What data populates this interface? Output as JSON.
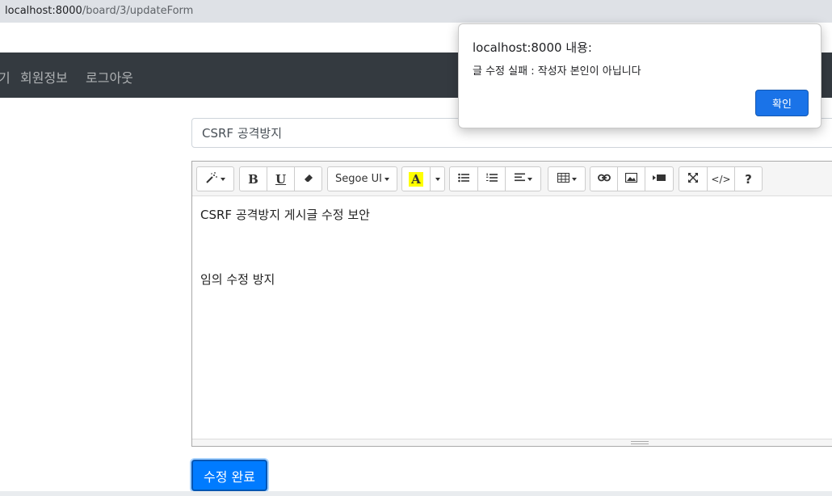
{
  "browser": {
    "url_host": "localhost:8000",
    "url_path": "/board/3/updateForm"
  },
  "navbar": {
    "items": [
      "기",
      "회원정보",
      "로그아웃"
    ]
  },
  "form": {
    "title_value": "CSRF 공격방지",
    "submit_label": "수정 완료"
  },
  "editor": {
    "toolbar": {
      "font_name": "Segoe UI",
      "bold": "B",
      "underline": "U",
      "forecolor_letter": "A",
      "codeview": "</>",
      "help": "?"
    },
    "content": {
      "line1": "CSRF 공격방지 게시글 수정 보안",
      "line2": "임의 수정 방지"
    }
  },
  "dialog": {
    "title": "localhost:8000 내용:",
    "message": "글 수정 실패 : 작성자 본인이 아닙니다",
    "ok_label": "확인"
  },
  "colors": {
    "navbar_bg": "#343a40",
    "primary": "#007bff",
    "dialog_button": "#1a73e8",
    "highlight": "#ffff00"
  }
}
